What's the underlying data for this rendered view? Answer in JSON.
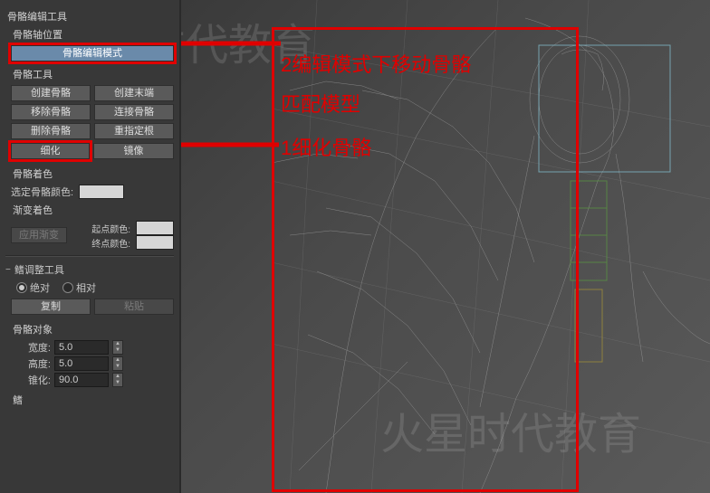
{
  "panel": {
    "title": "骨骼编辑工具",
    "pivot": {
      "label": "骨骼轴位置",
      "edit_mode_btn": "骨骼编辑模式"
    },
    "tools": {
      "label": "骨骼工具",
      "create_bone": "创建骨骼",
      "create_end": "创建末端",
      "remove_bone": "移除骨骼",
      "connect_bone": "连接骨骼",
      "delete_bone": "删除骨骼",
      "reassign_root": "重指定根",
      "refine": "细化",
      "mirror": "镜像"
    },
    "coloring": {
      "label": "骨骼着色",
      "selected_label": "选定骨骼颜色:",
      "gradient_label": "渐变着色",
      "apply_btn": "应用渐变",
      "start_label": "起点颜色:",
      "end_label": "终点颜色:"
    },
    "fin": {
      "title": "鳍调整工具",
      "absolute": "绝对",
      "relative": "相对",
      "copy": "复制",
      "paste": "粘贴"
    },
    "object": {
      "label": "骨骼对象",
      "width_label": "宽度:",
      "width_value": "5.0",
      "height_label": "高度:",
      "height_value": "5.0",
      "taper_label": "锥化:",
      "taper_value": "90.0",
      "fins": "鳍"
    }
  },
  "annotations": {
    "line1": "2编辑模式下移动骨骼",
    "line2": "匹配模型",
    "line3": "1细化骨骼"
  },
  "watermark": {
    "text1": "火星时代教育",
    "text2": "火星时代教育"
  },
  "colors": {
    "highlight": "#e00000",
    "panel_bg": "#383838",
    "viewport_bg": "#4a4a4a"
  }
}
